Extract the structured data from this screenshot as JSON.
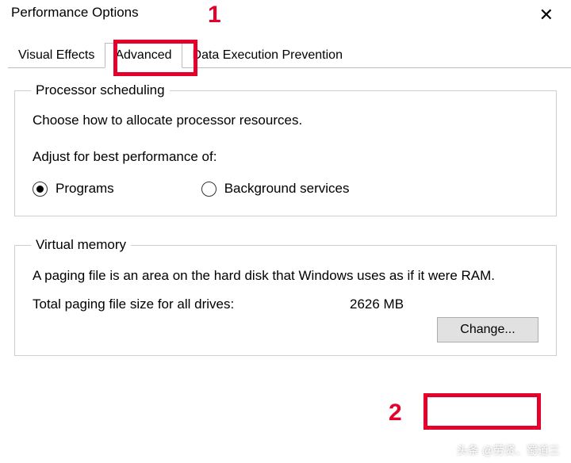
{
  "dialog": {
    "title": "Performance Options"
  },
  "tabs": {
    "visual_effects": "Visual Effects",
    "advanced": "Advanced",
    "dep": "Data Execution Prevention"
  },
  "processor": {
    "legend": "Processor scheduling",
    "desc": "Choose how to allocate processor resources.",
    "subhead": "Adjust for best performance of:",
    "programs": "Programs",
    "background": "Background services"
  },
  "vm": {
    "legend": "Virtual memory",
    "desc": "A paging file is an area on the hard disk that Windows uses as if it were RAM.",
    "total_label": "Total paging file size for all drives:",
    "total_value": "2626 MB",
    "change_btn": "Change..."
  },
  "annotations": {
    "a1": "1",
    "a2": "2",
    "watermark": "头条 @劳贤、蜀道三"
  }
}
